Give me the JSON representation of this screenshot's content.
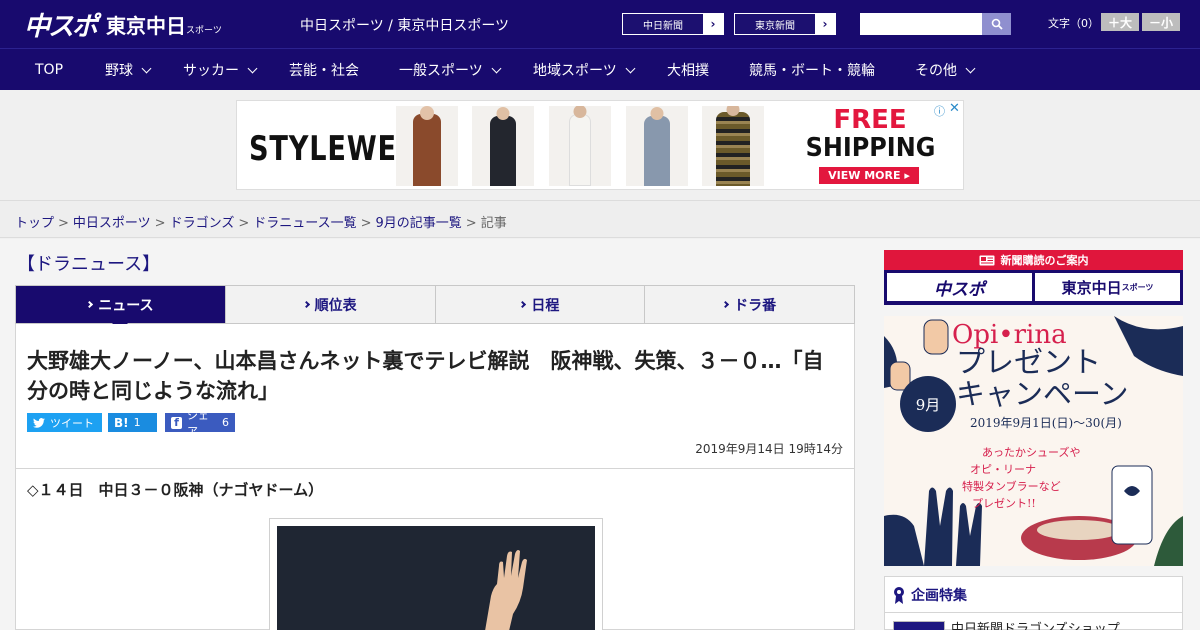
{
  "header": {
    "logo_main": "中スポ",
    "logo_sub": "東京中日",
    "logo_sub_small": "スポーツ",
    "site_name": "中日スポーツ / 東京中日スポーツ",
    "paper_links": [
      {
        "label": "中日新聞"
      },
      {
        "label": "東京新聞"
      }
    ],
    "search_placeholder": "",
    "font_size_label": "文字（0）",
    "font_up": "＋大",
    "font_down": "－小"
  },
  "nav": [
    {
      "label": "TOP",
      "has_menu": false
    },
    {
      "label": "野球",
      "has_menu": true
    },
    {
      "label": "サッカー",
      "has_menu": true
    },
    {
      "label": "芸能・社会",
      "has_menu": false
    },
    {
      "label": "一般スポーツ",
      "has_menu": true
    },
    {
      "label": "地域スポーツ",
      "has_menu": true
    },
    {
      "label": "大相撲",
      "has_menu": false
    },
    {
      "label": "競馬・ボート・競輪",
      "has_menu": false
    },
    {
      "label": "その他",
      "has_menu": true
    }
  ],
  "ad": {
    "brand": "STYLEWE",
    "headline1": "FREE",
    "headline2": "SHIPPING",
    "cta": "VIEW MORE ▸",
    "info": "ⓘ",
    "close": "✕",
    "colors": {
      "accent": "#e3173e"
    }
  },
  "breadcrumb": {
    "links": [
      "トップ",
      "中日スポーツ",
      "ドラゴンズ",
      "ドラニュース一覧",
      "9月の記事一覧"
    ],
    "current": "記事",
    "separator": ">"
  },
  "section_title": "【ドラニュース】",
  "tabs": [
    {
      "label": "ニュース",
      "active": true
    },
    {
      "label": "順位表",
      "active": false
    },
    {
      "label": "日程",
      "active": false
    },
    {
      "label": "ドラ番",
      "active": false
    }
  ],
  "article": {
    "headline": "大野雄大ノーノー、山本昌さんネット裏でテレビ解説　阪神戦、失策、３－０…「自分の時と同じような流れ」",
    "share": {
      "tweet_label": "ツイート",
      "hatena_glyph": "B!",
      "hatena_count": "1",
      "facebook_glyph": "f",
      "facebook_label": "シェア",
      "facebook_count": "6"
    },
    "date": "2019年9月14日 19時14分",
    "lede": "◇１４日　中日３－０阪神（ナゴヤドーム）"
  },
  "sidebar": {
    "subscribe_head": "新聞購読のご案内",
    "subscribe_logo_a": "中スポ",
    "subscribe_logo_b": "東京中日",
    "subscribe_logo_b_small": "スポーツ",
    "promo": {
      "brand": "Opi•rina",
      "title_line1": "プレゼント",
      "title_line2": "キャンペーン",
      "month": "9月",
      "dates": "2019年9月1日(日)〜30(月)",
      "copy_line1": "あったかシューズや",
      "copy_line2": "オピ・リーナ",
      "copy_line3": "特製タンブラーなど",
      "copy_line4": "プレゼント!!"
    },
    "feature_head": "企画特集",
    "feature_item": "中日新聞ドラゴンズショップ"
  },
  "colors": {
    "brand_navy": "#180a6e",
    "link": "#1d1780",
    "red": "#e0163c"
  }
}
